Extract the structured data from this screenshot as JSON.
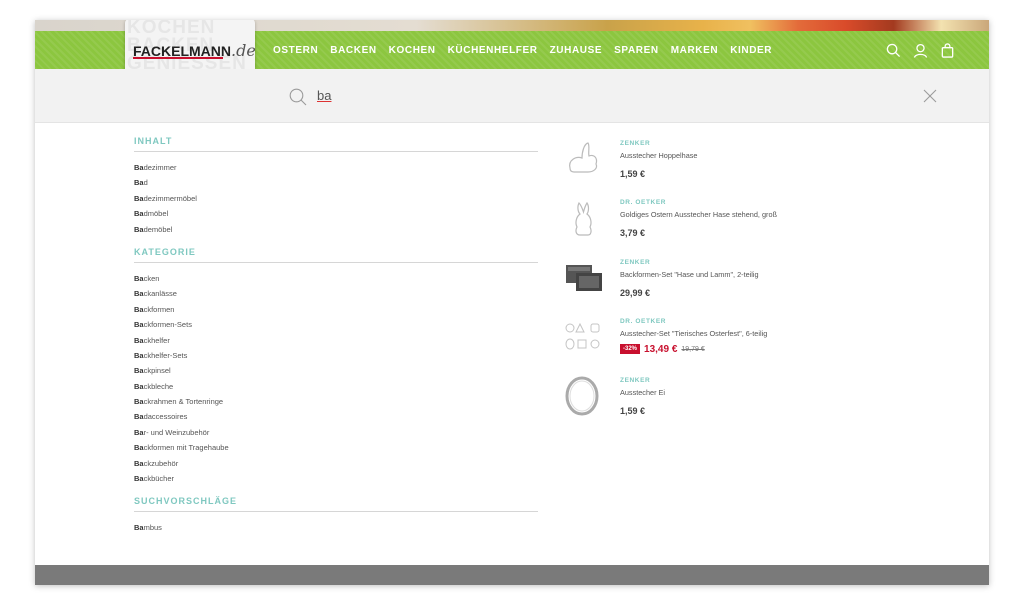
{
  "header": {
    "logo": {
      "text": "FACKELMANN",
      "tld": ".de",
      "bg_words": "KOCHEN\nBACKEN\nGENIESSEN"
    },
    "nav": [
      "OSTERN",
      "BACKEN",
      "KOCHEN",
      "KÜCHENHELFER",
      "ZUHAUSE",
      "SPAREN",
      "MARKEN",
      "KINDER"
    ],
    "icons": [
      "search-icon",
      "user-icon",
      "shopping-bag-icon"
    ],
    "accent_color": "#8cc63f"
  },
  "search": {
    "query": "ba"
  },
  "sections": {
    "inhalt": {
      "title": "INHALT",
      "items": [
        {
          "match": "Ba",
          "rest": "dezimmer"
        },
        {
          "match": "Ba",
          "rest": "d"
        },
        {
          "match": "Ba",
          "rest": "dezimmermöbel"
        },
        {
          "match": "Ba",
          "rest": "dmöbel"
        },
        {
          "match": "Ba",
          "rest": "demöbel"
        }
      ]
    },
    "kategorie": {
      "title": "KATEGORIE",
      "items": [
        {
          "match": "Ba",
          "rest": "cken"
        },
        {
          "match": "Ba",
          "rest": "ckanlässe"
        },
        {
          "match": "Ba",
          "rest": "ckformen"
        },
        {
          "match": "Ba",
          "rest": "ckformen-Sets"
        },
        {
          "match": "Ba",
          "rest": "ckhelfer"
        },
        {
          "match": "Ba",
          "rest": "ckhelfer-Sets"
        },
        {
          "match": "Ba",
          "rest": "ckpinsel"
        },
        {
          "match": "Ba",
          "rest": "ckbleche"
        },
        {
          "match": "Ba",
          "rest": "ckrahmen & Tortenringe"
        },
        {
          "match": "Ba",
          "rest": "daccessoires"
        },
        {
          "match": "Ba",
          "rest": "r- und Weinzubehör"
        },
        {
          "match": "Ba",
          "rest": "ckformen mit Tragehaube"
        },
        {
          "match": "Ba",
          "rest": "ckzubehör"
        },
        {
          "match": "Ba",
          "rest": "ckbücher"
        }
      ]
    },
    "vorschlaege": {
      "title": "SUCHVORSCHLÄGE",
      "items": [
        {
          "match": "Ba",
          "rest": "mbus"
        }
      ]
    }
  },
  "products": [
    {
      "brand": "ZENKER",
      "name": "Ausstecher Hoppelhase",
      "price": "1,59 €",
      "icon": "bunny-cutter-icon"
    },
    {
      "brand": "DR. OETKER",
      "name": "Goldiges Ostern Ausstecher Hase stehend, groß",
      "price": "3,79 €",
      "icon": "standing-bunny-cutter-icon"
    },
    {
      "brand": "ZENKER",
      "name": "Backformen-Set \"Hase und Lamm\", 2-teilig",
      "price": "29,99 €",
      "icon": "baking-mold-set-icon"
    },
    {
      "brand": "DR. OETKER",
      "name": "Ausstecher-Set \"Tierisches Osterfest\", 6-teilig",
      "badge": "-32%",
      "sale_price": "13,49 €",
      "old_price": "19,79 €",
      "icon": "cutter-set-icon"
    },
    {
      "brand": "ZENKER",
      "name": "Ausstecher Ei",
      "price": "1,59 €",
      "icon": "egg-cutter-icon"
    }
  ],
  "colors": {
    "section_heading": "#7fc8c0",
    "sale": "#c8102e",
    "footer": "#7a7a7a"
  }
}
